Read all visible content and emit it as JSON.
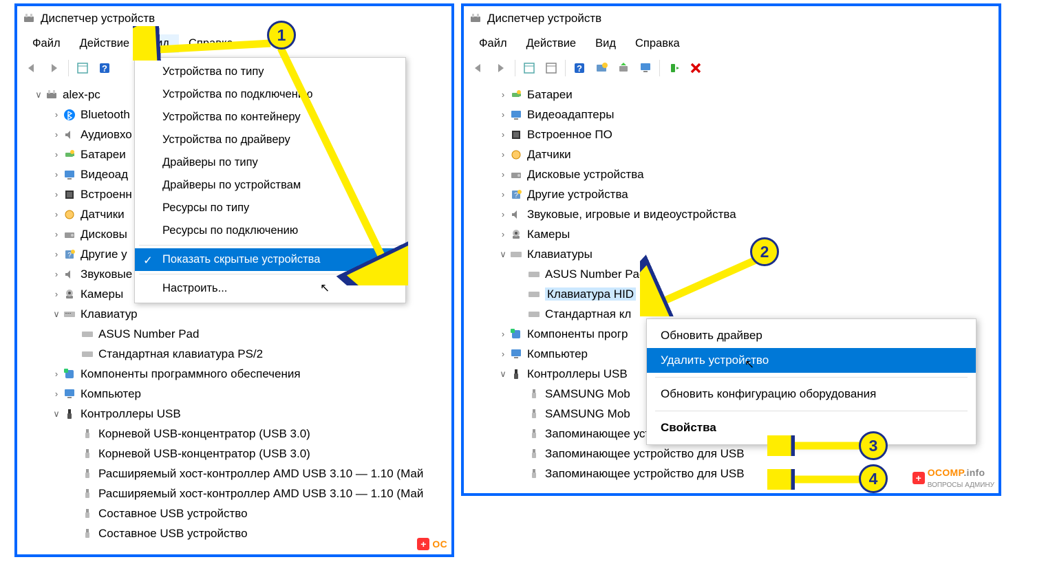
{
  "window_title": "Диспетчер устройств",
  "menubar": {
    "file": "Файл",
    "action": "Действие",
    "view": "Вид",
    "help": "Справка"
  },
  "left": {
    "root": "alex-pc",
    "tree": [
      {
        "label": "Bluetooth",
        "icon": "bluetooth"
      },
      {
        "label": "Аудиовхо",
        "icon": "audio"
      },
      {
        "label": "Батареи",
        "icon": "battery"
      },
      {
        "label": "Видеоад",
        "icon": "display"
      },
      {
        "label": "Встроенн",
        "icon": "firmware"
      },
      {
        "label": "Датчики",
        "icon": "sensor"
      },
      {
        "label": "Дисковы",
        "icon": "disk"
      },
      {
        "label": "Другие у",
        "icon": "other"
      },
      {
        "label": "Звуковые",
        "icon": "audio"
      },
      {
        "label": "Камеры",
        "icon": "camera"
      }
    ],
    "keyboards_label": "Клавиатур",
    "kb_children": [
      "ASUS Number Pad",
      "Стандартная клавиатура PS/2"
    ],
    "sw_components": "Компоненты программного обеспечения",
    "computer": "Компьютер",
    "usb_label": "Контроллеры USB",
    "usb_children": [
      "Корневой USB-концентратор (USB 3.0)",
      "Корневой USB-концентратор (USB 3.0)",
      "Расширяемый хост-контроллер AMD USB 3.10 — 1.10 (Май",
      "Расширяемый хост-контроллер AMD USB 3.10 — 1.10 (Май",
      "Составное USB устройство",
      "Составное USB устройство"
    ],
    "view_menu": {
      "by_type": "Устройства по типу",
      "by_conn": "Устройства по подключению",
      "by_cont": "Устройства по контейнеру",
      "by_drv": "Устройства по драйверу",
      "drv_type": "Драйверы по типу",
      "drv_dev": "Драйверы по устройствам",
      "res_type": "Ресурсы по типу",
      "res_conn": "Ресурсы по подключению",
      "show_hidden": "Показать скрытые устройства",
      "customize": "Настроить..."
    }
  },
  "right": {
    "tree": [
      {
        "label": "Батареи",
        "icon": "battery"
      },
      {
        "label": "Видеоадаптеры",
        "icon": "display"
      },
      {
        "label": "Встроенное ПО",
        "icon": "firmware"
      },
      {
        "label": "Датчики",
        "icon": "sensor"
      },
      {
        "label": "Дисковые устройства",
        "icon": "disk"
      },
      {
        "label": "Другие устройства",
        "icon": "other"
      },
      {
        "label": "Звуковые, игровые и видеоустройства",
        "icon": "audio"
      },
      {
        "label": "Камеры",
        "icon": "camera"
      }
    ],
    "keyboards_label": "Клавиатуры",
    "kb_children": [
      "ASUS Number Pad",
      "Клавиатура HID",
      "Стандартная кл"
    ],
    "sw_components": "Компоненты прогр",
    "computer": "Компьютер",
    "usb_label": "Контроллеры USB",
    "usb_children": [
      "SAMSUNG Mob",
      "SAMSUNG Mob",
      "Запоминающее устройство для USB",
      "Запоминающее устройство для USB",
      "Запоминающее устройство для USB"
    ],
    "context_menu": {
      "update": "Обновить драйвер",
      "uninstall": "Удалить устройство",
      "scan": "Обновить конфигурацию оборудования",
      "props": "Свойства"
    }
  },
  "callouts": {
    "n1": "1",
    "n2": "2",
    "n3": "3",
    "n4": "4"
  },
  "watermark": {
    "plus": "+",
    "main": "OCOMP",
    "suffix": ".info",
    "sub": "ВОПРОСЫ АДМИНУ"
  }
}
